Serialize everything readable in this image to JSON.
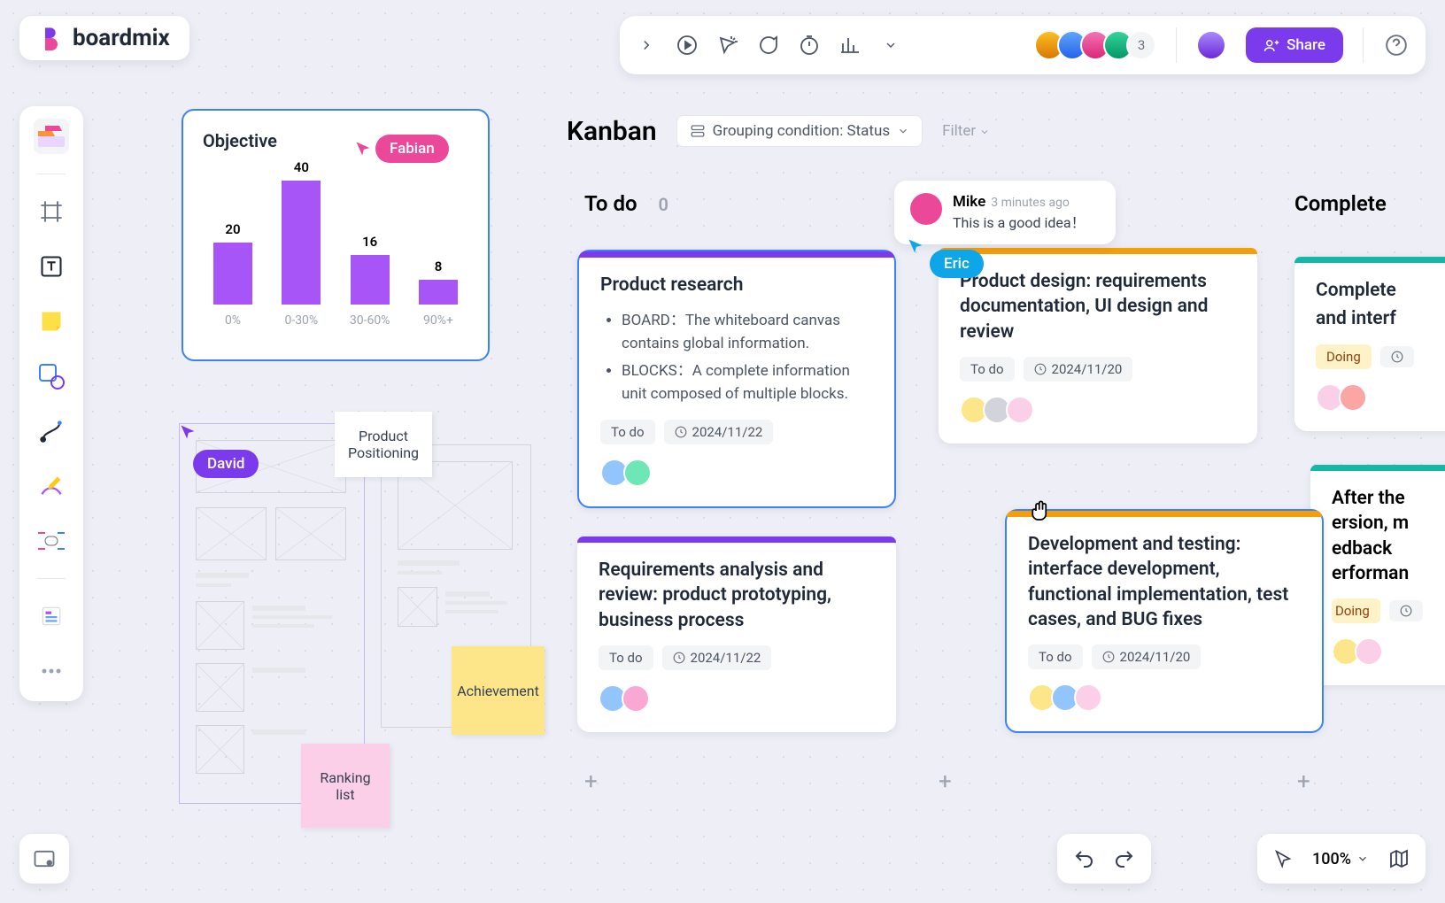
{
  "logo": {
    "text": "boardmix"
  },
  "toolbar": {
    "avatar_count": "3",
    "share_label": "Share"
  },
  "cursors": {
    "fabian": "Fabian",
    "david": "David",
    "eric": "Eric"
  },
  "stickies": {
    "positioning": "Product\nPositioning",
    "achievement": "Achievement",
    "ranking": "Ranking\nlist"
  },
  "kanban": {
    "title": "Kanban",
    "grouping": "Grouping condition: Status",
    "filter": "Filter",
    "columns": {
      "todo": {
        "name": "To do",
        "count": "0"
      },
      "completed": {
        "name": "Complete"
      }
    }
  },
  "cards": {
    "c1": {
      "title": "Product research",
      "bullet1": "BOARD：The whiteboard canvas contains global information.",
      "bullet2": "BLOCKS：A complete information unit composed of multiple blocks.",
      "status": "To do",
      "date": "2024/11/22"
    },
    "c2": {
      "title": "Requirements analysis and review: product prototyping, business process",
      "status": "To do",
      "date": "2024/11/22"
    },
    "c3": {
      "title": "Product design: requirements documentation, UI design and review",
      "status": "To do",
      "date": "2024/11/20"
    },
    "c4": {
      "title": "Development and testing: interface development, functional implementation, test cases, and BUG fixes",
      "status": "To do",
      "date": "2024/11/20"
    },
    "c5": {
      "title": "Complete",
      "line2": "and interf",
      "status": "Doing"
    },
    "c6": {
      "title": "After the",
      "l2": "ersion, m",
      "l3": "edback",
      "l4": "erforman",
      "status": "Doing"
    }
  },
  "comment": {
    "name": "Mike",
    "time": "3 minutes ago",
    "text": "This is a good idea！"
  },
  "bottom_right": {
    "zoom": "100%"
  },
  "chart_data": {
    "type": "bar",
    "title": "Objective",
    "categories": [
      "0%",
      "0-30%",
      "30-60%",
      "90%+"
    ],
    "values": [
      20,
      40,
      16,
      8
    ],
    "ylim": [
      0,
      40
    ]
  },
  "chart_labels": {
    "v0": "20",
    "v1": "40",
    "v2": "16",
    "v3": "8",
    "c0": "0%",
    "c1": "0-30%",
    "c2": "30-60%",
    "c3": "90%+"
  }
}
